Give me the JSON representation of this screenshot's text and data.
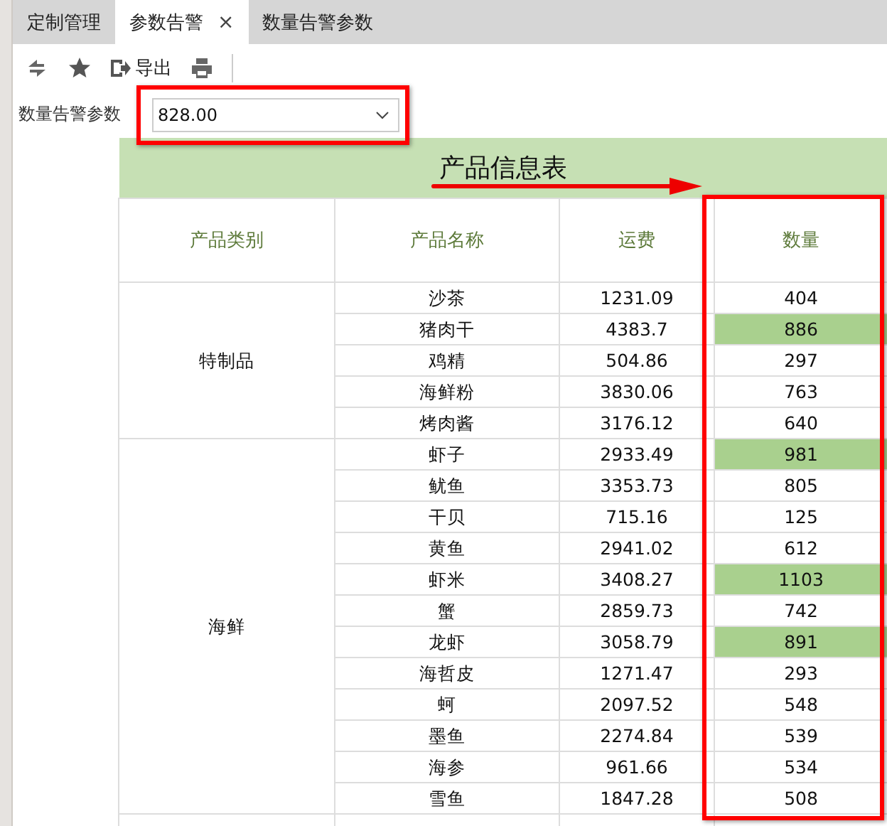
{
  "tabs": [
    {
      "label": "定制管理",
      "selected": false
    },
    {
      "label": "参数告警",
      "selected": true,
      "close": "×"
    },
    {
      "label": "数量告警参数",
      "selected": false
    }
  ],
  "toolbar": {
    "export_label": "导出"
  },
  "parameter": {
    "label": "数量告警参数",
    "value": "828.00"
  },
  "table": {
    "title": "产品信息表",
    "columns": [
      "产品类别",
      "产品名称",
      "运费",
      "数量"
    ],
    "groups": [
      {
        "category": "特制品",
        "rows": [
          {
            "name": "沙茶",
            "freight": "1231.09",
            "quantity": "404",
            "highlighted": false
          },
          {
            "name": "猪肉干",
            "freight": "4383.7",
            "quantity": "886",
            "highlighted": true
          },
          {
            "name": "鸡精",
            "freight": "504.86",
            "quantity": "297",
            "highlighted": false
          },
          {
            "name": "海鲜粉",
            "freight": "3830.06",
            "quantity": "763",
            "highlighted": false
          },
          {
            "name": "烤肉酱",
            "freight": "3176.12",
            "quantity": "640",
            "highlighted": false
          }
        ]
      },
      {
        "category": "海鲜",
        "rows": [
          {
            "name": "虾子",
            "freight": "2933.49",
            "quantity": "981",
            "highlighted": true
          },
          {
            "name": "鱿鱼",
            "freight": "3353.73",
            "quantity": "805",
            "highlighted": false
          },
          {
            "name": "干贝",
            "freight": "715.16",
            "quantity": "125",
            "highlighted": false
          },
          {
            "name": "黄鱼",
            "freight": "2941.02",
            "quantity": "612",
            "highlighted": false
          },
          {
            "name": "虾米",
            "freight": "3408.27",
            "quantity": "1103",
            "highlighted": true
          },
          {
            "name": "蟹",
            "freight": "2859.73",
            "quantity": "742",
            "highlighted": false
          },
          {
            "name": "龙虾",
            "freight": "3058.79",
            "quantity": "891",
            "highlighted": true
          },
          {
            "name": "海哲皮",
            "freight": "1271.47",
            "quantity": "293",
            "highlighted": false
          },
          {
            "name": "蚵",
            "freight": "2097.52",
            "quantity": "548",
            "highlighted": false
          },
          {
            "name": "墨鱼",
            "freight": "2274.84",
            "quantity": "539",
            "highlighted": false
          },
          {
            "name": "海参",
            "freight": "961.66",
            "quantity": "534",
            "highlighted": false
          },
          {
            "name": "雪鱼",
            "freight": "1847.28",
            "quantity": "508",
            "highlighted": false
          }
        ]
      }
    ]
  }
}
